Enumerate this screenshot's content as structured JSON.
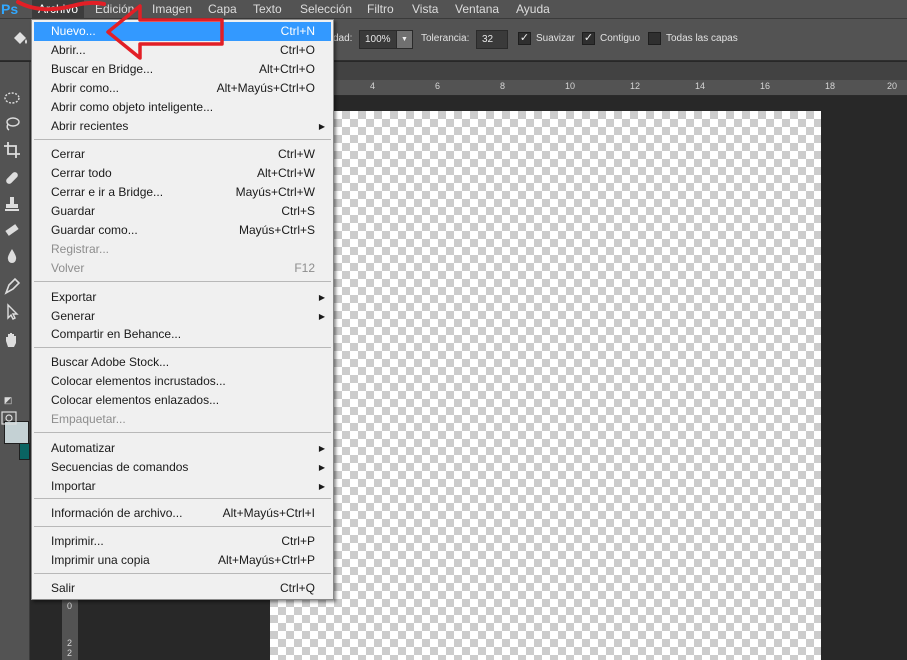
{
  "app": {
    "logo": "Ps"
  },
  "menubar": {
    "items": [
      "Archivo",
      "Edición",
      "Imagen",
      "Capa",
      "Texto",
      "Selección",
      "Filtro",
      "Vista",
      "Ventana",
      "Ayuda"
    ]
  },
  "options": {
    "opacity_label": "dad:",
    "opacity_value": "100%",
    "tolerance_label": "Tolerancia:",
    "tolerance_value": "32",
    "smooth_label": "Suavizar",
    "contiguous_label": "Contiguo",
    "all_layers_label": "Todas las capas",
    "smooth_checked": true,
    "contiguous_checked": true,
    "all_layers_checked": false
  },
  "ruler": {
    "top_numbers": [
      "4",
      "6",
      "8",
      "10",
      "12",
      "14",
      "16",
      "18",
      "20"
    ],
    "left_numbers": [
      "0",
      "2",
      "2"
    ]
  },
  "colors": {
    "foreground": "#c4d1d4",
    "background": "#0a6462",
    "highlight": "#3399ff",
    "annotation": "#e21f26"
  },
  "file_menu": {
    "items": [
      {
        "label": "Nuevo...",
        "shortcut": "Ctrl+N",
        "highlighted": true
      },
      {
        "label": "Abrir...",
        "shortcut": "Ctrl+O"
      },
      {
        "label": "Buscar en Bridge...",
        "shortcut": "Alt+Ctrl+O"
      },
      {
        "label": "Abrir como...",
        "shortcut": "Alt+Mayús+Ctrl+O"
      },
      {
        "label": "Abrir como objeto inteligente...",
        "shortcut": ""
      },
      {
        "label": "Abrir recientes",
        "shortcut": "",
        "submenu": true
      },
      {
        "label": "Cerrar",
        "shortcut": "Ctrl+W"
      },
      {
        "label": "Cerrar todo",
        "shortcut": "Alt+Ctrl+W"
      },
      {
        "label": "Cerrar e ir a Bridge...",
        "shortcut": "Mayús+Ctrl+W"
      },
      {
        "label": "Guardar",
        "shortcut": "Ctrl+S"
      },
      {
        "label": "Guardar como...",
        "shortcut": "Mayús+Ctrl+S"
      },
      {
        "label": "Registrar...",
        "shortcut": "",
        "disabled": true
      },
      {
        "label": "Volver",
        "shortcut": "F12",
        "disabled": true
      },
      {
        "label": "Exportar",
        "shortcut": "",
        "submenu": true
      },
      {
        "label": "Generar",
        "shortcut": "",
        "submenu": true
      },
      {
        "label": "Compartir en Behance...",
        "shortcut": ""
      },
      {
        "label": "Buscar Adobe Stock...",
        "shortcut": ""
      },
      {
        "label": "Colocar elementos incrustados...",
        "shortcut": ""
      },
      {
        "label": "Colocar elementos enlazados...",
        "shortcut": ""
      },
      {
        "label": "Empaquetar...",
        "shortcut": "",
        "disabled": true
      },
      {
        "label": "Automatizar",
        "shortcut": "",
        "submenu": true
      },
      {
        "label": "Secuencias de comandos",
        "shortcut": "",
        "submenu": true
      },
      {
        "label": "Importar",
        "shortcut": "",
        "submenu": true
      },
      {
        "label": "Información de archivo...",
        "shortcut": "Alt+Mayús+Ctrl+I"
      },
      {
        "label": "Imprimir...",
        "shortcut": "Ctrl+P"
      },
      {
        "label": "Imprimir una copia",
        "shortcut": "Alt+Mayús+Ctrl+P"
      },
      {
        "label": "Salir",
        "shortcut": "Ctrl+Q"
      }
    ]
  }
}
